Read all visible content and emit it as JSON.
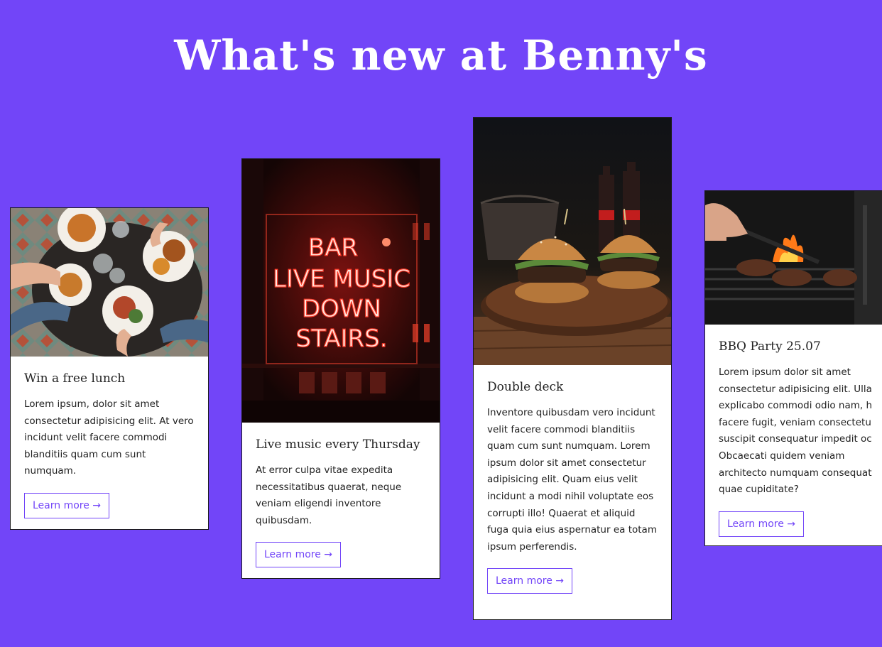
{
  "page": {
    "title": "What's new at Benny's"
  },
  "colors": {
    "background": "#7245f8",
    "accent": "#7245f8",
    "card_bg": "#ffffff"
  },
  "cards": [
    {
      "image": "food-table-overhead-image",
      "title": "Win a free lunch",
      "text": "Lorem ipsum, dolor sit amet consectetur adipisicing elit. At vero incidunt velit facere commodi blanditiis quam cum sunt numquam.",
      "button": "Learn more →"
    },
    {
      "image": "neon-sign-image",
      "image_text": [
        "BAR",
        "LIVE MUSIC",
        "DOWN",
        "STAIRS."
      ],
      "title": "Live music every Thursday",
      "text": "At error culpa vitae expedita necessitatibus quaerat, neque veniam eligendi inventore quibusdam.",
      "button": "Learn more →"
    },
    {
      "image": "burgers-on-board-image",
      "title": "Double deck",
      "text": "Inventore quibusdam vero incidunt velit facere commodi blanditiis quam cum sunt numquam. Lorem ipsum dolor sit amet consectetur adipisicing elit. Quam eius velit incidunt a modi nihil voluptate eos corrupti illo! Quaerat et aliquid fuga quia eius aspernatur ea totam ipsum perferendis.",
      "button": "Learn more →"
    },
    {
      "image": "bbq-grill-image",
      "title": "BBQ Party 25.07",
      "text": "Lorem ipsum dolor sit amet consectetur adipisicing elit. Ulla explicabo commodi odio nam, h facere fugit, veniam consectetu suscipit consequatur impedit oc Obcaecati quidem veniam architecto numquam consequat quae cupiditate?",
      "button": "Learn more →"
    }
  ]
}
